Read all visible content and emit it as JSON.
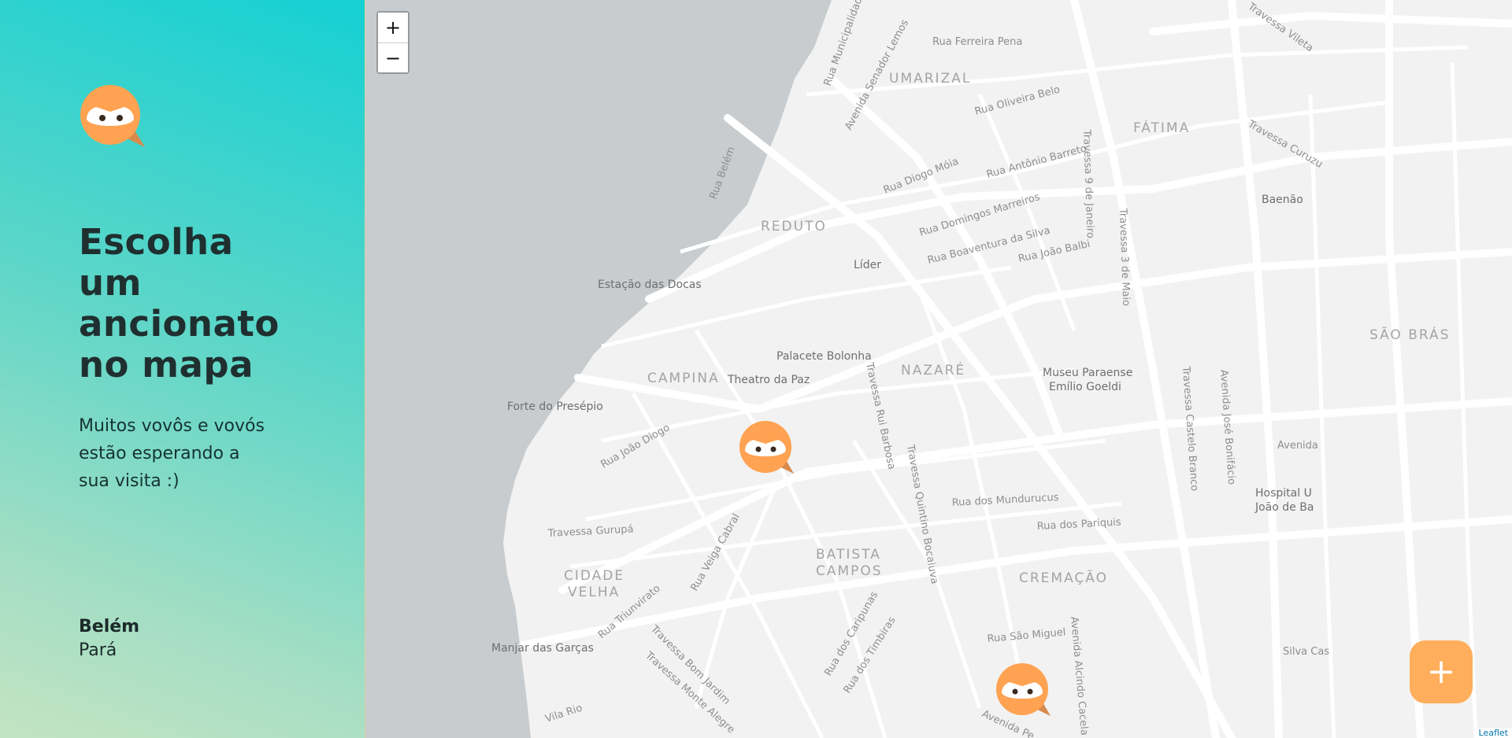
{
  "sidebar": {
    "logo_icon": "owl-chat-icon",
    "title": "Escolha um ancionato no mapa",
    "subtitle": "Muitos vovôs e vovós estão esperando a sua visita :)",
    "city": "Belém",
    "state": "Pará"
  },
  "map": {
    "zoom_in_label": "+",
    "zoom_out_label": "−",
    "fab_label": "+",
    "attribution": "Leaflet",
    "districts": [
      "UMARIZAL",
      "FÁTIMA",
      "REDUTO",
      "SÃO BRÁS",
      "NAZARÉ",
      "CAMPINA",
      "BATISTA CAMPOS",
      "CIDADE VELHA",
      "CREMAÇÃO"
    ],
    "pois": [
      "Estação das Docas",
      "Palacete Bolonha",
      "Theatro da Paz",
      "Forte do Presépio",
      "Museu Paraense Emílio Goeldi",
      "Líder",
      "Baenão",
      "Manjar das Garças",
      "Hospital U João de Ba"
    ],
    "streets": [
      "Rua Ferreira Pena",
      "Rua Municipalidade",
      "Avenida Senador Lemos",
      "Rua Oliveira Belo",
      "Rua Diogo Móia",
      "Rua Antônio Barreto",
      "Rua Domingos Marreiros",
      "Rua Boaventura da Silva",
      "Rua João Balbi",
      "Rua Belém",
      "Travessa 9 de Janeiro",
      "Travessa 3 de Maio",
      "Travessa Rui Barbosa",
      "Travessa Quintino Bocaiuva",
      "Rua João Diogo",
      "Travessa Gurupá",
      "Rua Veiga Cabral",
      "Rua dos Mundurucus",
      "Rua dos Pariquis",
      "Rua Triunvirato",
      "Travessa Bom Jardim",
      "Travessa Monte Alegre",
      "Rua dos Caripunas",
      "Rua dos Timbiras",
      "Rua São Miguel",
      "Avenida Alcindo Cacela",
      "Travessa Castelo Branco",
      "Avenida José Bonifácio",
      "Vila Rio",
      "Travessa Vileta",
      "Travessa Curuzu",
      "Avenida",
      "Silva Cas",
      "Avenida Pe"
    ],
    "marker_count": 2,
    "colors": {
      "accent": "#ffae5b",
      "marker_eye": "#ffffff",
      "water": "#c8ccce",
      "land": "#f2f2f2"
    }
  }
}
